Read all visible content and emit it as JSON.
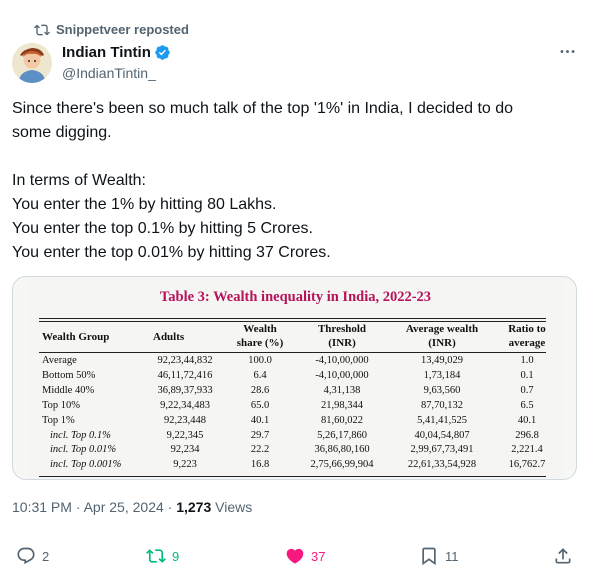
{
  "repost": {
    "label": "Snippetveer reposted",
    "icon": "repost-icon"
  },
  "author": {
    "name": "Indian Tintin",
    "handle": "@IndianTintin_",
    "verified_color": "#1d9bf0"
  },
  "tweet": {
    "line1": "Since there's been so much talk of the top '1%' in India, I decided to do",
    "line2": "some digging.",
    "line3": "In terms of Wealth:",
    "line4": "You enter the 1% by hitting 80 Lakhs.",
    "line5": "You enter the top 0.1% by hitting 5 Crores.",
    "line6": "You enter the top 0.01% by hitting 37 Crores."
  },
  "table": {
    "title": "Table 3: Wealth inequality in India, 2022-23",
    "title_color": "#b5135a",
    "headers": {
      "group": "Wealth Group",
      "adults": "Adults",
      "share1": "Wealth",
      "share2": "share (%)",
      "threshold1": "Threshold",
      "threshold2": "(INR)",
      "avg1": "Average wealth",
      "avg2": "(INR)",
      "ratio1": "Ratio to",
      "ratio2": "average"
    },
    "rows": [
      {
        "group": "Average",
        "adults": "92,23,44,832",
        "share": "100.0",
        "threshold": "-4,10,00,000",
        "avg": "13,49,029",
        "ratio": "1.0",
        "italic": false
      },
      {
        "group": "Bottom 50%",
        "adults": "46,11,72,416",
        "share": "6.4",
        "threshold": "-4,10,00,000",
        "avg": "1,73,184",
        "ratio": "0.1",
        "italic": false
      },
      {
        "group": "Middle 40%",
        "adults": "36,89,37,933",
        "share": "28.6",
        "threshold": "4,31,138",
        "avg": "9,63,560",
        "ratio": "0.7",
        "italic": false
      },
      {
        "group": "Top 10%",
        "adults": "9,22,34,483",
        "share": "65.0",
        "threshold": "21,98,344",
        "avg": "87,70,132",
        "ratio": "6.5",
        "italic": false
      },
      {
        "group": "Top 1%",
        "adults": "92,23,448",
        "share": "40.1",
        "threshold": "81,60,022",
        "avg": "5,41,41,525",
        "ratio": "40.1",
        "italic": false
      },
      {
        "group": "incl. Top 0.1%",
        "adults": "9,22,345",
        "share": "29.7",
        "threshold": "5,26,17,860",
        "avg": "40,04,54,807",
        "ratio": "296.8",
        "italic": true
      },
      {
        "group": "incl. Top 0.01%",
        "adults": "92,234",
        "share": "22.2",
        "threshold": "36,86,80,160",
        "avg": "2,99,67,73,491",
        "ratio": "2,221.4",
        "italic": true
      },
      {
        "group": "incl. Top 0.001%",
        "adults": "9,223",
        "share": "16.8",
        "threshold": "2,75,66,99,904",
        "avg": "22,61,33,54,928",
        "ratio": "16,762.7",
        "italic": true
      }
    ]
  },
  "meta": {
    "time": "10:31 PM · Apr 25, 2024 · ",
    "views_count": "1,273",
    "views_label": " Views"
  },
  "actions": {
    "replies": "2",
    "reposts": "9",
    "likes": "37",
    "bookmarks": "11",
    "repost_color": "#00ba7c",
    "like_color": "#f91880"
  }
}
